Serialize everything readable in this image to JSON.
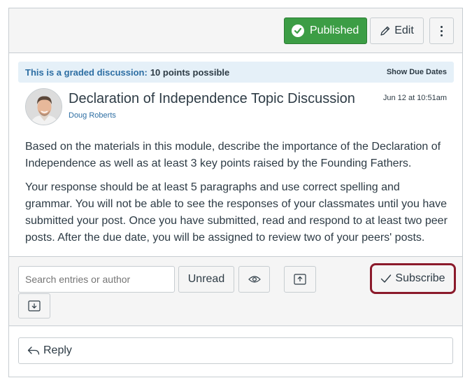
{
  "header": {
    "published_label": "Published",
    "edit_label": "Edit"
  },
  "banner": {
    "lead": "This is a graded discussion:",
    "points": "10 points possible",
    "show_due_dates": "Show Due Dates"
  },
  "topic": {
    "title": "Declaration of Independence Topic Discussion",
    "author": "Doug Roberts",
    "date": "Jun 12 at 10:51am",
    "paragraphs": [
      "Based on the materials in this module, describe the importance of the Declaration of Independence as well as at least 3 key points raised by the Founding Fathers.",
      "Your response should be at least 5 paragraphs and use correct spelling and grammar. You will not be able to see the responses of your classmates until you have submitted your post. Once you have submitted, read and respond to at least two peer posts. After the due date, you will be assigned to review two of your peers' posts."
    ]
  },
  "toolbar": {
    "search_placeholder": "Search entries or author",
    "unread_label": "Unread",
    "subscribe_label": "Subscribe"
  },
  "reply": {
    "label": "Reply"
  },
  "colors": {
    "published_green": "#3c9d45",
    "link_blue": "#2d6ea3",
    "highlight_ring": "#8b1a2b"
  },
  "icons": [
    "check-circle-icon",
    "pencil-icon",
    "kebab-icon",
    "eye-icon",
    "collapse-icon",
    "expand-icon",
    "checkmark-icon",
    "reply-arrow-icon"
  ]
}
